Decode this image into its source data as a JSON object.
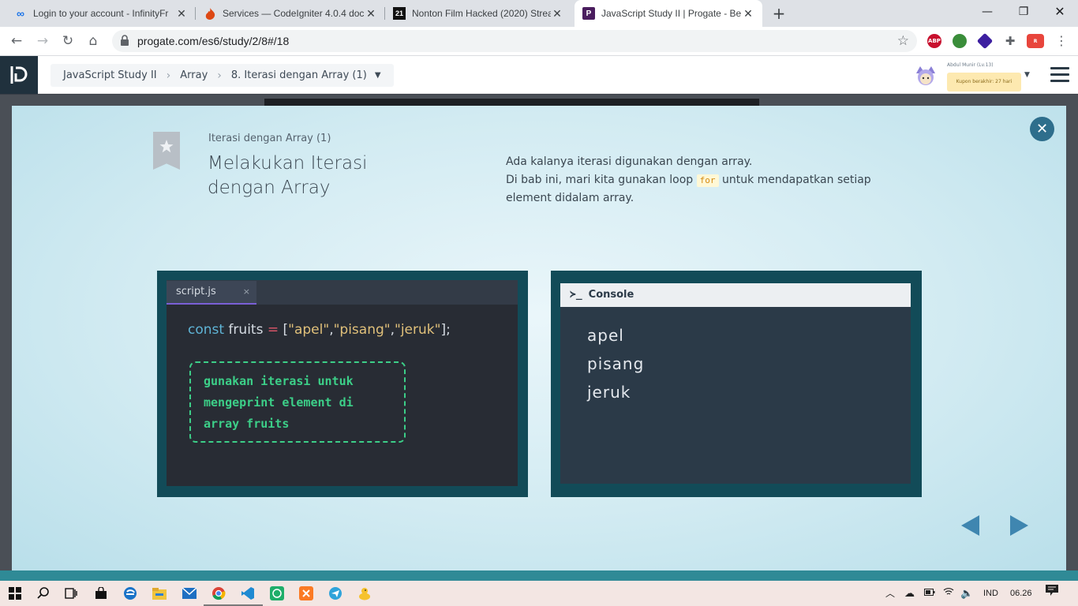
{
  "browser": {
    "tabs": [
      {
        "title": "Login to your account - InfinityFr",
        "icon": "infinity-icon"
      },
      {
        "title": "Services — CodeIgniter 4.0.4 doc",
        "icon": "codeigniter-flame-icon"
      },
      {
        "title": "Nonton Film Hacked (2020) Strea",
        "icon": "film-site-icon",
        "icon_text": "21"
      },
      {
        "title": "JavaScript Study II | Progate - Bel",
        "icon": "progate-icon"
      }
    ],
    "new_tab_label": "+",
    "url": "progate.com/es6/study/2/8#/18",
    "extensions": [
      {
        "label": "ABP",
        "color": "#c8102e"
      },
      {
        "label": "",
        "color": "#3a8d3a"
      },
      {
        "label": "",
        "color": "#3d1fa0"
      },
      {
        "label": "",
        "color": "#5f6368"
      },
      {
        "label": "",
        "color": "#e8453c"
      }
    ]
  },
  "header": {
    "breadcrumb": [
      "JavaScript Study II",
      "Array",
      "8. Iterasi dengan Array (1)"
    ],
    "user_name": "Abdul Munir (Lv.13)",
    "coupon": "Kupon berakhir: 27 hari"
  },
  "slide": {
    "subtitle": "Iterasi dengan Array (1)",
    "title_line1": "Melakukan Iterasi",
    "title_line2": "dengan Array",
    "desc_line1": "Ada kalanya iterasi digunakan dengan array.",
    "desc_line2_before": "Di bab ini, mari kita gunakan loop",
    "desc_code": "for",
    "desc_line2_after": "untuk mendapatkan setiap",
    "desc_line3": "element didalam array."
  },
  "editor": {
    "file_tab": "script.js",
    "close_glyph": "×",
    "code": {
      "keyword": "const",
      "name": " fruits ",
      "op": "=",
      "open": " [",
      "s1": "\"apel\"",
      "c1": ",",
      "s2": "\"pisang\"",
      "c2": ",",
      "s3": "\"jeruk\"",
      "close": "];"
    },
    "hint_lines": [
      "gunakan iterasi untuk",
      "mengeprint element di",
      "array fruits"
    ]
  },
  "console": {
    "prompt": "≻_",
    "title": "Console",
    "output": [
      "apel",
      "pisang",
      "jeruk"
    ]
  },
  "taskbar": {
    "language": "IND",
    "time": "06.26"
  }
}
